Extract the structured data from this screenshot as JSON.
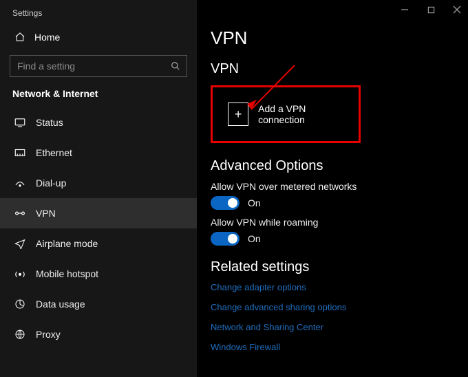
{
  "app_title": "Settings",
  "home_label": "Home",
  "search_placeholder": "Find a setting",
  "category": "Network & Internet",
  "sidebar_items": [
    {
      "id": "status",
      "label": "Status"
    },
    {
      "id": "ethernet",
      "label": "Ethernet"
    },
    {
      "id": "dialup",
      "label": "Dial-up"
    },
    {
      "id": "vpn",
      "label": "VPN"
    },
    {
      "id": "airplane",
      "label": "Airplane mode"
    },
    {
      "id": "hotspot",
      "label": "Mobile hotspot"
    },
    {
      "id": "datausage",
      "label": "Data usage"
    },
    {
      "id": "proxy",
      "label": "Proxy"
    }
  ],
  "page_title": "VPN",
  "section_vpn": "VPN",
  "add_label": "Add a VPN connection",
  "advanced_title": "Advanced Options",
  "toggle_metered_label": "Allow VPN over metered networks",
  "toggle_metered_state": "On",
  "toggle_roaming_label": "Allow VPN while roaming",
  "toggle_roaming_state": "On",
  "related_title": "Related settings",
  "links": [
    "Change adapter options",
    "Change advanced sharing options",
    "Network and Sharing Center",
    "Windows Firewall"
  ]
}
